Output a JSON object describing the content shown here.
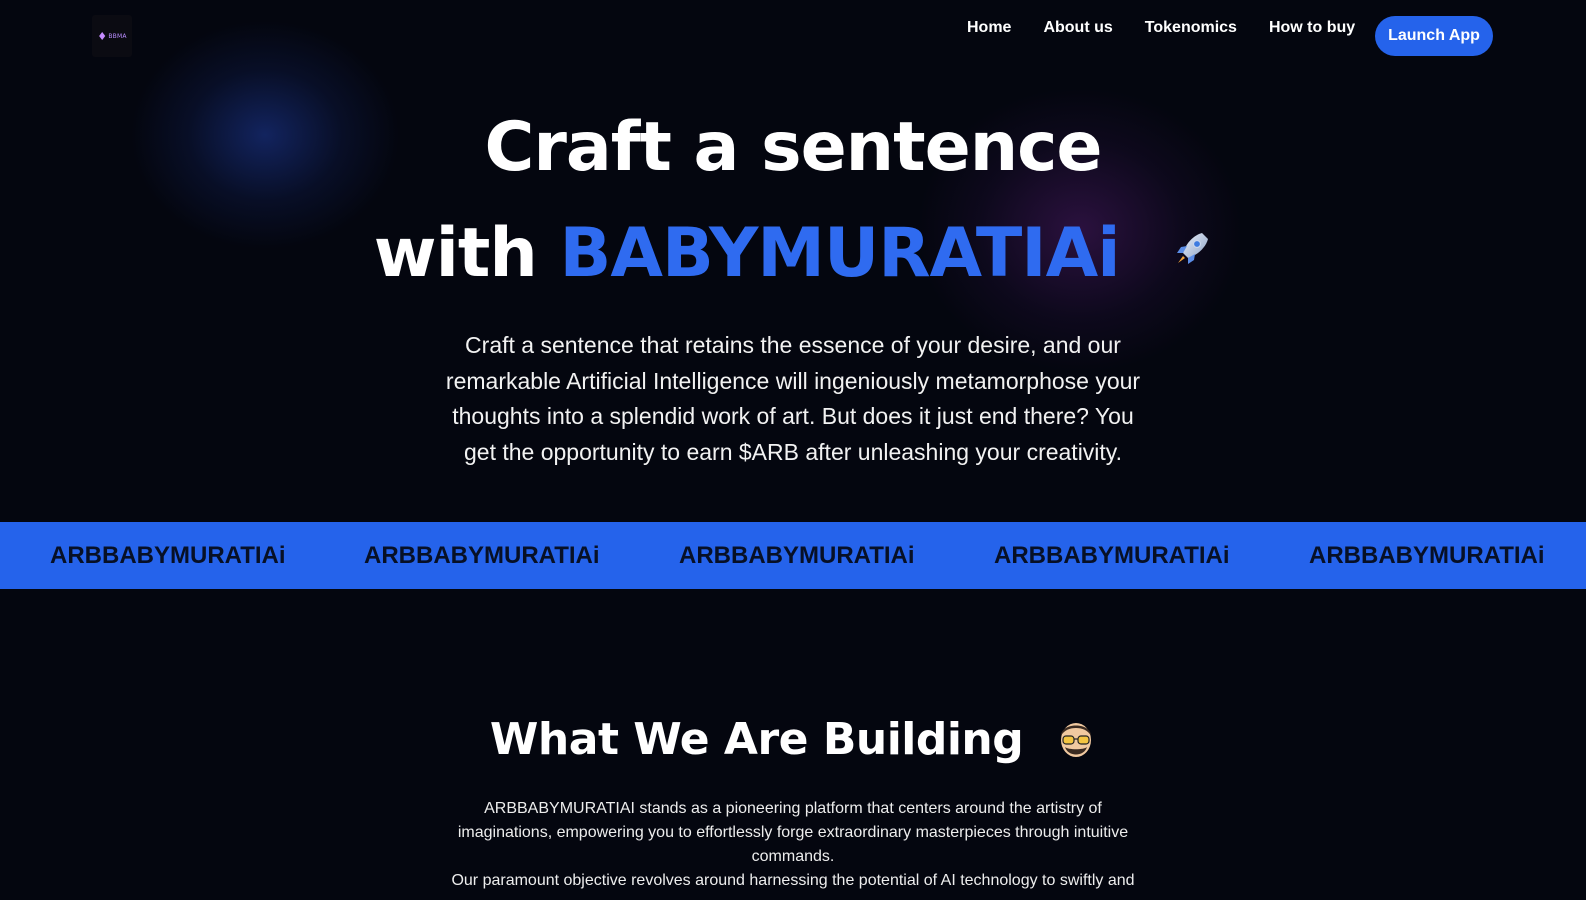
{
  "header": {
    "logo_text": "BBMA",
    "nav": [
      "Home",
      "About us",
      "Tokenomics",
      "How to buy"
    ],
    "launch_label": "Launch App"
  },
  "hero": {
    "line1": "Craft a sentence",
    "line2_prefix": "with",
    "line2_accent": "BABYMURATIAi",
    "description": "Craft a sentence that retains the essence of your desire, and our remarkable Artificial Intelligence will ingeniously metamorphose your thoughts into a splendid work of art. But does it just end there? You get the opportunity to earn $ARB after unleashing your creativity."
  },
  "ticker": {
    "items": [
      "ARBBABYMURATIAi",
      "ARBBABYMURATIAi",
      "ARBBABYMURATIAi",
      "ARBBABYMURATIAi",
      "ARBBABYMURATIAi"
    ]
  },
  "building": {
    "title": "What We Are Building",
    "paragraph1": "ARBBABYMURATIAI stands as a pioneering platform that centers around the artistry of imaginations, empowering you to effortlessly forge extraordinary masterpieces through intuitive commands.",
    "paragraph2": "Our paramount objective revolves around harnessing the potential of AI technology to swiftly and"
  },
  "colors": {
    "background": "#04060f",
    "accent": "#2563eb",
    "accent_text": "#2f6bf0",
    "ticker_text": "#071026"
  },
  "icons": {
    "rocket": "rocket-icon",
    "face": "nerd-face-icon"
  }
}
